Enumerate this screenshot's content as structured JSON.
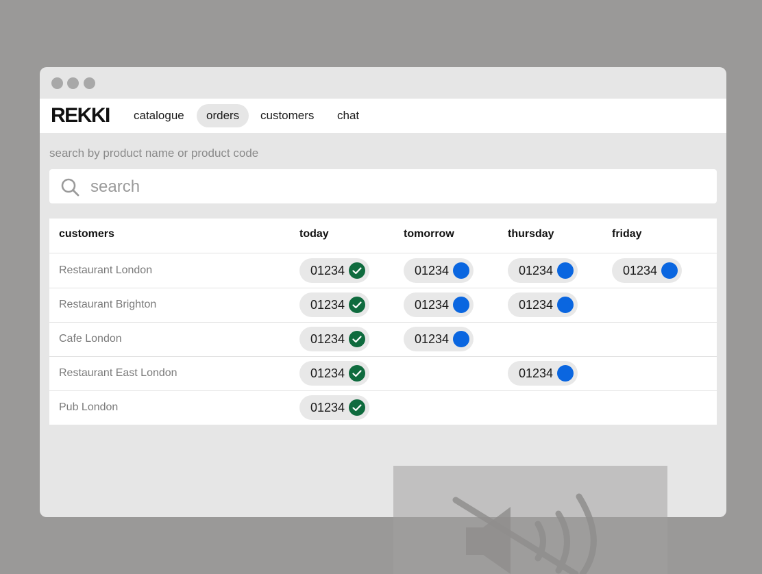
{
  "brand": {
    "logo": "REKKI"
  },
  "nav": [
    {
      "label": "catalogue",
      "active": false
    },
    {
      "label": "orders",
      "active": true
    },
    {
      "label": "customers",
      "active": false
    },
    {
      "label": "chat",
      "active": false
    }
  ],
  "search": {
    "label": "search by product name or product code",
    "placeholder": "search"
  },
  "table": {
    "columns": [
      "customers",
      "today",
      "tomorrow",
      "thursday",
      "friday"
    ],
    "rows": [
      {
        "customer": "Restaurant London",
        "orders": {
          "today": "01234",
          "tomorrow": "01234",
          "thursday": "01234",
          "friday": "01234"
        }
      },
      {
        "customer": "Restaurant Brighton",
        "orders": {
          "today": "01234",
          "tomorrow": "01234",
          "thursday": "01234"
        }
      },
      {
        "customer": "Cafe London",
        "orders": {
          "today": "01234",
          "tomorrow": "01234"
        }
      },
      {
        "customer": "Restaurant East London",
        "orders": {
          "today": "01234",
          "thursday": "01234"
        }
      },
      {
        "customer": "Pub London",
        "orders": {
          "today": "01234"
        }
      }
    ]
  },
  "status": {
    "confirmed": {
      "icon": "check-circle-icon",
      "color": "#0f6b3e"
    },
    "pending": {
      "icon": "blue-dot-icon",
      "color": "#0a66e0"
    }
  },
  "overlay": {
    "icon": "muted-speaker-icon"
  }
}
